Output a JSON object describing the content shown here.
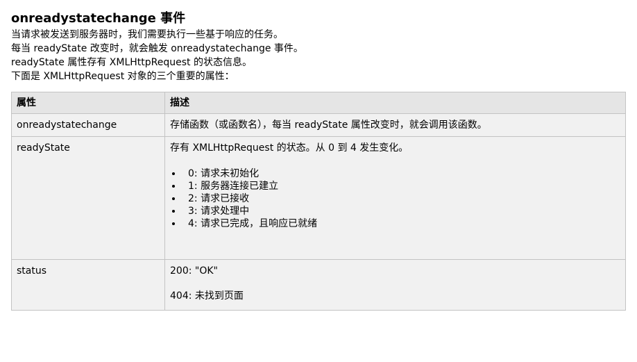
{
  "page": {
    "title": "onreadystatechange 事件",
    "paragraphs": [
      "当请求被发送到服务器时，我们需要执行一些基于响应的任务。",
      "每当 readyState 改变时，就会触发 onreadystatechange 事件。",
      "readyState 属性存有 XMLHttpRequest 的状态信息。",
      "下面是 XMLHttpRequest 对象的三个重要的属性："
    ]
  },
  "table": {
    "headers": [
      "属性",
      "描述"
    ],
    "rows": [
      {
        "property": "onreadystatechange",
        "description": "存储函数（或函数名），每当 readyState 属性改变时，就会调用该函数。"
      },
      {
        "property": "readyState",
        "description": "存有 XMLHttpRequest 的状态。从 0 到 4 发生变化。",
        "states": [
          "0: 请求未初始化",
          "1: 服务器连接已建立",
          "2: 请求已接收",
          "3: 请求处理中",
          "4: 请求已完成，且响应已就绪"
        ]
      },
      {
        "property": "status",
        "description_lines": [
          "200: \"OK\"",
          "404: 未找到页面"
        ]
      }
    ]
  }
}
